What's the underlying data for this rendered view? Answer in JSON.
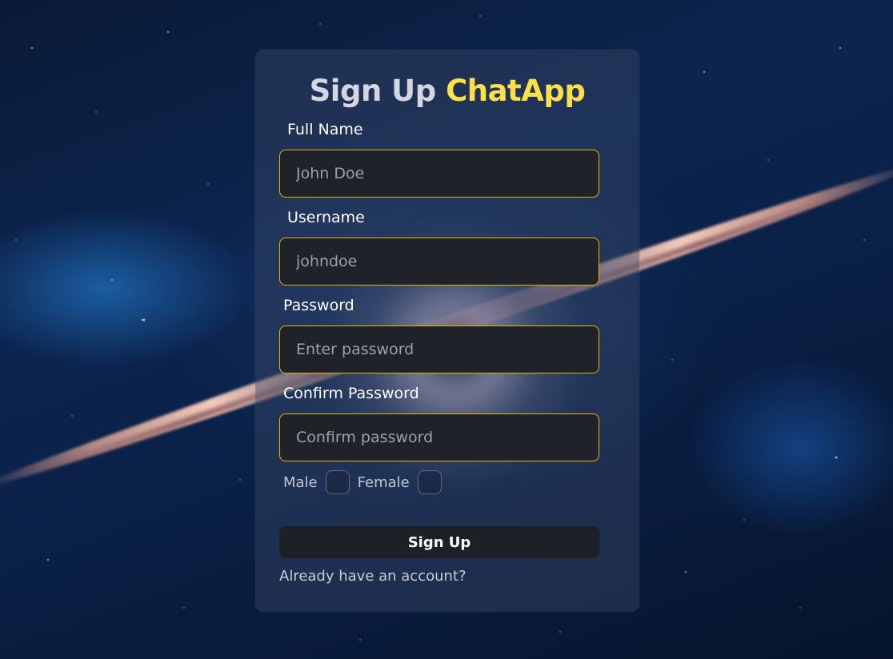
{
  "title": {
    "prefix": "Sign Up",
    "brand": "ChatApp"
  },
  "fields": [
    {
      "label": "Full Name",
      "placeholder": "John Doe",
      "value": ""
    },
    {
      "label": "Username",
      "placeholder": "johndoe",
      "value": ""
    },
    {
      "label": "Password",
      "placeholder": "Enter password",
      "value": ""
    },
    {
      "label": "Confirm Password",
      "placeholder": "Confirm password",
      "value": ""
    }
  ],
  "gender": {
    "male_label": "Male",
    "female_label": "Female"
  },
  "submit_label": "Sign Up",
  "login_link_label": "Already have an account?",
  "colors": {
    "accent": "#fde047",
    "input_border": "#eab308",
    "input_bg": "#1f2329",
    "button_bg": "#1d2026"
  }
}
